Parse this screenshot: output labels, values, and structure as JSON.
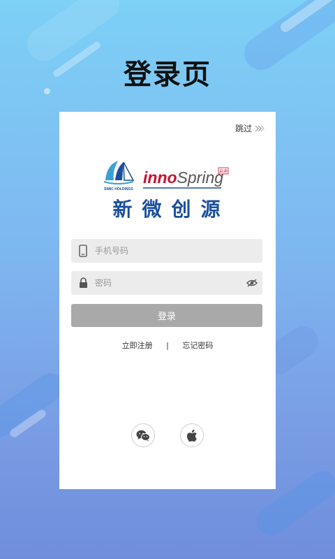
{
  "page_title": "登录页",
  "skip": {
    "label": "跳过"
  },
  "logo": {
    "holdings_text": "SIMIC HOLDINGS",
    "brand_en": "InnoSpring",
    "brand_cn": "新微创源",
    "seal_text": "启迪"
  },
  "form": {
    "phone_placeholder": "手机号码",
    "password_placeholder": "密码",
    "login_label": "登录"
  },
  "links": {
    "register": "立即注册",
    "separator": "|",
    "forgot": "忘记密码"
  },
  "social": {
    "wechat_icon": "wechat-icon",
    "apple_icon": "apple-icon"
  },
  "colors": {
    "brand_blue": "#1b4f9c",
    "button_disabled": "#a9a9a9",
    "input_bg": "#ececec",
    "brand_red": "#c8102e"
  }
}
